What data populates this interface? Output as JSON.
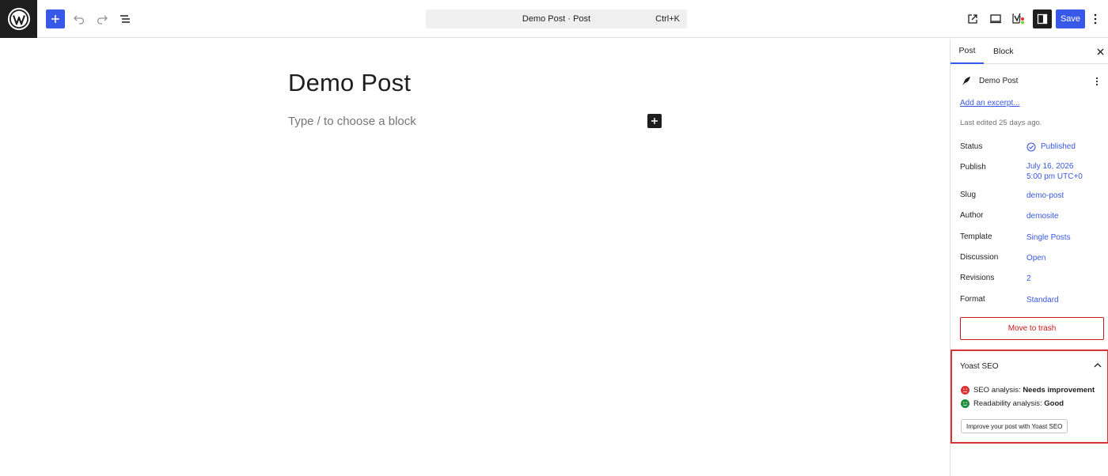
{
  "header": {
    "document_title": "Demo Post · Post",
    "shortcut": "Ctrl+K",
    "save_label": "Save"
  },
  "editor": {
    "post_title": "Demo Post",
    "block_placeholder": "Type / to choose a block"
  },
  "sidebar": {
    "tabs": [
      {
        "label": "Post",
        "active": true
      },
      {
        "label": "Block",
        "active": false
      }
    ],
    "post_card": {
      "title": "Demo Post",
      "excerpt_link": "Add an excerpt...",
      "last_edited": "Last edited 25 days ago."
    },
    "meta": [
      {
        "label": "Status",
        "value": "Published"
      },
      {
        "label": "Publish",
        "value": "July 16, 2026",
        "value_line2": "5:00 pm UTC+0"
      },
      {
        "label": "Slug",
        "value": "demo-post"
      },
      {
        "label": "Author",
        "value": "demosite"
      },
      {
        "label": "Template",
        "value": "Single Posts"
      },
      {
        "label": "Discussion",
        "value": "Open"
      },
      {
        "label": "Revisions",
        "value": "2"
      },
      {
        "label": "Format",
        "value": "Standard"
      }
    ],
    "trash_label": "Move to trash",
    "yoast": {
      "title": "Yoast SEO",
      "seo_label": "SEO analysis: ",
      "seo_value": "Needs improvement",
      "readability_label": "Readability analysis: ",
      "readability_value": "Good",
      "improve_button": "Improve your post with Yoast SEO"
    }
  },
  "colors": {
    "accent": "#3858e9",
    "danger": "#cc1818",
    "highlight_border": "#d63638",
    "seo_bad": "#dc3232",
    "seo_good": "#1e8c3a"
  },
  "icons": {
    "logo": "wordpress-logo-icon",
    "add": "plus-icon",
    "undo": "undo-icon",
    "redo": "redo-icon",
    "list_view": "list-view-icon",
    "view_post": "external-link-icon",
    "preview": "desktop-preview-icon",
    "yoast": "yoast-icon",
    "settings": "sidebar-settings-icon",
    "options": "vertical-ellipsis-icon",
    "close": "close-icon",
    "post": "quill-icon",
    "status": "check-circle-icon",
    "collapse": "chevron-up-icon"
  }
}
